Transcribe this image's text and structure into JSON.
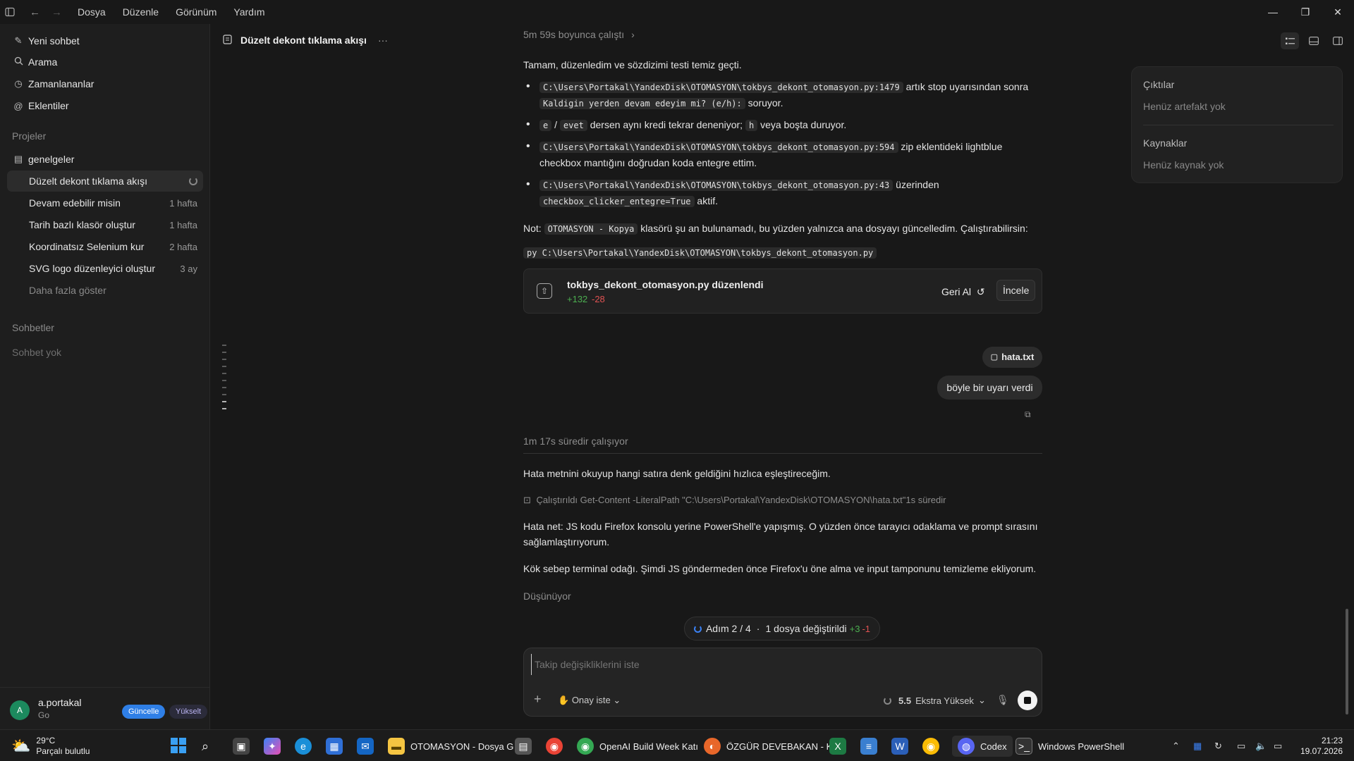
{
  "titlebar": {
    "menus": [
      "Dosya",
      "Düzenle",
      "Görünüm",
      "Yardım"
    ]
  },
  "sidebar": {
    "actions": [
      {
        "label": "Yeni sohbet",
        "icon": "edit-icon"
      },
      {
        "label": "Arama",
        "icon": "search-icon"
      },
      {
        "label": "Zamanlananlar",
        "icon": "clock-icon"
      },
      {
        "label": "Eklentiler",
        "icon": "at-icon"
      }
    ],
    "projects_heading": "Projeler",
    "project_name": "genelgeler",
    "threads": [
      {
        "title": "Düzelt dekont tıklama akışı",
        "age": ""
      },
      {
        "title": "Devam edebilir misin",
        "age": "1 hafta"
      },
      {
        "title": "Tarih bazlı klasör oluştur",
        "age": "1 hafta"
      },
      {
        "title": "Koordinatsız Selenium kur",
        "age": "2 hafta"
      },
      {
        "title": "SVG logo düzenleyici oluştur",
        "age": "3 ay"
      }
    ],
    "show_more": "Daha fazla göster",
    "chats_heading": "Sohbetler",
    "no_chats": "Sohbet yok"
  },
  "user": {
    "avatar_letter": "A",
    "name": "a.portakal",
    "plan": "Go",
    "update_label": "Güncelle",
    "upgrade_label": "Yükselt"
  },
  "header": {
    "title": "Düzelt dekont tıklama akışı",
    "more": "···"
  },
  "convo": {
    "worked_for": "5m 59s boyunca çalıştı",
    "intro": "Tamam, düzenledim ve sözdizimi testi temiz geçti.",
    "b1_code1": "C:\\Users\\Portakal\\YandexDisk\\OTOMASYON\\tokbys_dekont_otomasyon.py:1479",
    "b1_text1": "artık stop uyarısından sonra",
    "b1_code2": "Kaldigin yerden devam edeyim mi? (e/h):",
    "b1_text2": "soruyor.",
    "b2_code1": "e",
    "b2_sep": "/",
    "b2_code2": "evet",
    "b2_text1": "dersen aynı kredi tekrar deneniyor;",
    "b2_code3": "h",
    "b2_text2": "veya boşta duruyor.",
    "b3_code1": "C:\\Users\\Portakal\\YandexDisk\\OTOMASYON\\tokbys_dekont_otomasyon.py:594",
    "b3_text1": "zip eklentideki lightblue",
    "b3_text2": "checkbox mantığını doğrudan koda entegre ettim.",
    "b4_code1": "C:\\Users\\Portakal\\YandexDisk\\OTOMASYON\\tokbys_dekont_otomasyon.py:43",
    "b4_text1": "üzerinden",
    "b4_code2": "checkbox_clicker_entegre=True",
    "b4_text2": "aktif.",
    "note_label": "Not:",
    "note_code": "OTOMASYON - Kopya",
    "note_text": "klasörü şu an bulunamadı, bu yüzden yalnızca ana dosyayı güncelledim. Çalıştırabilirsin:",
    "run_cmd": "py C:\\Users\\Portakal\\YandexDisk\\OTOMASYON\\tokbys_dekont_otomasyon.py",
    "file_card": {
      "title": "tokbys_dekont_otomasyon.py düzenlendi",
      "added": "+132",
      "removed": "-28",
      "undo_label": "Geri Al",
      "review_label": "İncele"
    },
    "attachment": "hata.txt",
    "user_message": "böyle bir uyarı verdi",
    "working_for": "1m 17s süredir çalışıyor",
    "p1": "Hata metnini okuyup hangi satıra denk geldiğini hızlıca eşleştireceğim.",
    "command_run": "Çalıştırıldı Get-Content -LiteralPath \"C:\\Users\\Portakal\\YandexDisk\\OTOMASYON\\hata.txt\"1s süredir",
    "p2": "Hata net: JS kodu Firefox konsolu yerine PowerShell'e yapışmış. O yüzden önce tarayıcı odaklama ve prompt sırasını sağlamlaştırıyorum.",
    "p3": "Kök sebep terminal odağı. Şimdi JS göndermeden önce Firefox'u öne alma ve input tamponunu temizleme ekliyorum.",
    "thinking": "Düşünüyor"
  },
  "steps": {
    "step": "Adım 2 / 4",
    "dot": "·",
    "files": "1 dosya değiştirildi",
    "added": "+3",
    "removed": "-1"
  },
  "composer": {
    "placeholder": "Takip değişikliklerini iste",
    "approval": "Onay iste",
    "model": "5.5",
    "effort": "Ekstra Yüksek"
  },
  "right_panel": {
    "outputs_heading": "Çıktılar",
    "no_artifacts": "Henüz artefakt yok",
    "sources_heading": "Kaynaklar",
    "no_sources": "Henüz kaynak yok"
  },
  "taskbar": {
    "weather_temp": "29°C",
    "weather_desc": "Parçalı bulutlu",
    "apps": [
      {
        "label": "OTOMASYON - Dosya G"
      },
      {
        "label": "OpenAI Build Week Katı"
      },
      {
        "label": "ÖZGÜR DEVEBAKAN - K"
      },
      {
        "label": "Codex"
      },
      {
        "label": "Windows PowerShell"
      }
    ],
    "time": "21:23",
    "date": "19.07.2026"
  },
  "colors": {
    "accent_blue": "#3b82f6",
    "added_green": "#4caf50",
    "removed_red": "#e05252"
  }
}
